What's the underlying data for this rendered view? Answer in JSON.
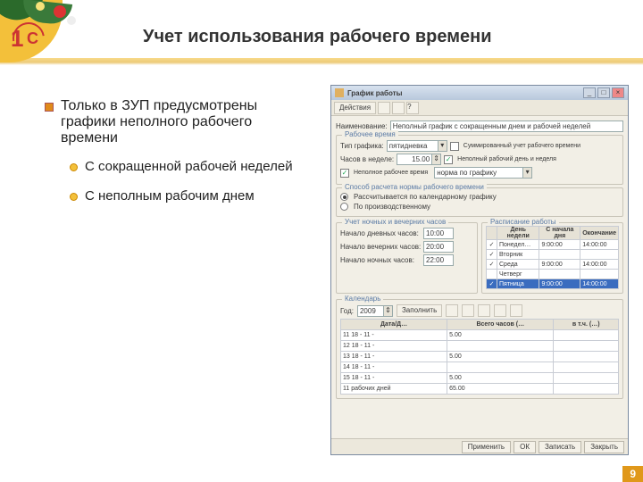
{
  "slide": {
    "title": "Учет использования рабочего времени",
    "page_number": "9"
  },
  "bullets": {
    "main": "Только в ЗУП предусмотрены графики неполного рабочего времени",
    "sub1": "С сокращенной рабочей неделей",
    "sub2": "С неполным рабочим днем"
  },
  "window": {
    "title": "График работы",
    "toolbar": {
      "actions": "Действия"
    },
    "name_label": "Наименование:",
    "name_value": "Неполный график с сокращенным днем и рабочей неделей",
    "work_time_section": "Рабочее время",
    "type_label": "Тип графика:",
    "type_value": "пятидневка",
    "hours_label": "Часов в неделе:",
    "hours_value": "15.00",
    "chk_summ": "Суммированный учет рабочего времени",
    "chk_partial": "Неполный рабочий день и неделя",
    "chk_reduce": "Неполное рабочее время",
    "norm_label": "норма по графику",
    "norm_calc_section": "Способ расчета нормы рабочего времени",
    "radio1": "Рассчитывается по календарному графику",
    "radio2": "По производственному",
    "evening_section": "Учет ночных и вечерних часов",
    "night_label": "Начало дневных часов:",
    "night_value": "10:00",
    "evening_label": "Начало вечерних часов:",
    "evening_value": "20:00",
    "nightstart_label": "Начало ночных часов:",
    "nightstart_value": "22:00",
    "sched_section": "Расписание работы",
    "sched": {
      "head_day": "День недели",
      "head_start": "С начала дня",
      "head_end": "Окончание",
      "rows": [
        {
          "chk": true,
          "day": "Понедел…",
          "s": "9:00:00",
          "e": "14:00:00"
        },
        {
          "chk": true,
          "day": "Вторник",
          "s": "",
          "e": ""
        },
        {
          "chk": true,
          "day": "Среда",
          "s": "9:00:00",
          "e": "14:00:00"
        },
        {
          "chk": false,
          "day": "Четверг",
          "s": "",
          "e": ""
        },
        {
          "chk": true,
          "day": "Пятница",
          "s": "9:00:00",
          "e": "14:00:00"
        }
      ]
    },
    "calendar_section": "Календарь",
    "cal_year_label": "Год:",
    "cal_year": "2009",
    "cal_fill": "Заполнить",
    "cal": {
      "head_date": "Дата/Д…",
      "head_hours": "Всего часов (…",
      "head_extra": "в т.ч. (…)",
      "rows": [
        {
          "d": "11 18 - 11 -",
          "h": "5.00",
          "e": ""
        },
        {
          "d": "12 18 - 11 -",
          "h": "",
          "e": ""
        },
        {
          "d": "13 18 - 11 -",
          "h": "5.00",
          "e": ""
        },
        {
          "d": "14 18 - 11 -",
          "h": "",
          "e": ""
        },
        {
          "d": "15 18 - 11 -",
          "h": "5.00",
          "e": ""
        }
      ],
      "total_label": "11 рабочих дней",
      "total_hours": "65.00"
    },
    "buttons": {
      "apply": "Применить",
      "ok": "ОК",
      "save": "Записать",
      "close": "Закрыть"
    }
  }
}
